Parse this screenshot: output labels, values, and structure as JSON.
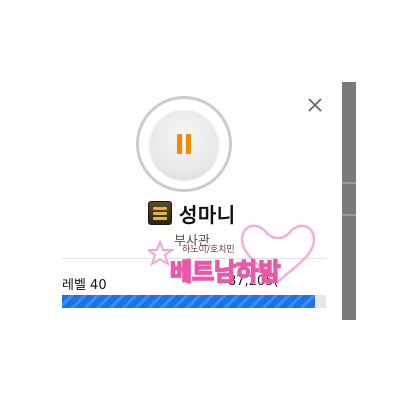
{
  "profile": {
    "name": "성마니",
    "rank_title": "부사관",
    "level_label": "레벨 40",
    "xp_text": "87,205(",
    "xp_progress": 0.96
  },
  "watermark": {
    "main_text": "베트남하밤",
    "sub_text": "하노이/호치민"
  },
  "colors": {
    "accent_orange": "#f08a00",
    "progress_blue": "#1a73e8",
    "watermark_pink": "#f2a6d6"
  },
  "icons": {
    "close": "close-icon",
    "pause": "pause-icon",
    "rank": "rank-badge-icon",
    "star": "star-icon"
  }
}
